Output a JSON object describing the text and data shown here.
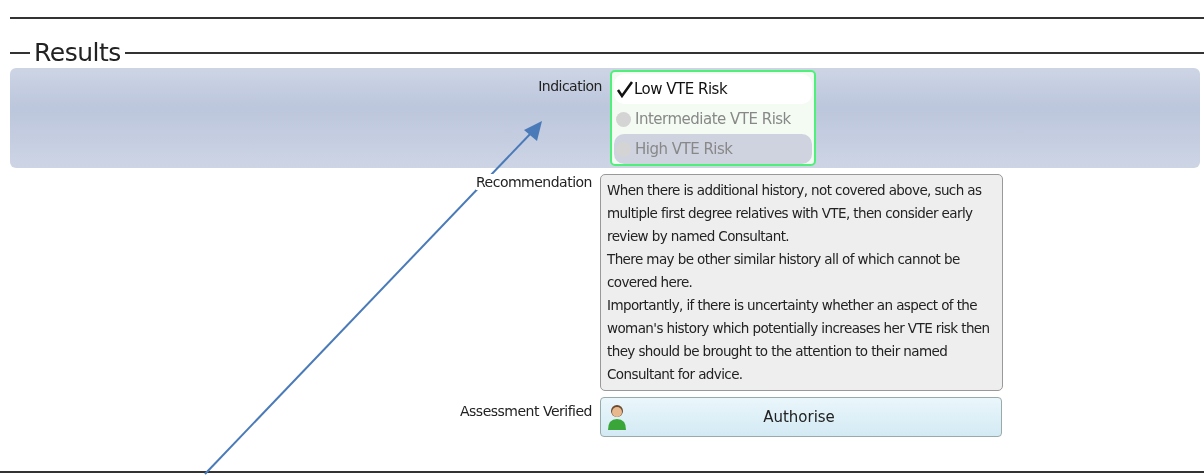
{
  "section": {
    "title": "Results"
  },
  "indication": {
    "label": "Indication",
    "options": [
      {
        "label": "Low VTE Risk",
        "selected": true,
        "hovered": false
      },
      {
        "label": "Intermediate VTE Risk",
        "selected": false,
        "hovered": false
      },
      {
        "label": "High VTE Risk",
        "selected": false,
        "hovered": true
      }
    ]
  },
  "recommendation": {
    "label": "Recommendation",
    "paragraphs": [
      "When there is additional history, not covered above, such as multiple first degree relatives with VTE, then consider early review by named Consultant.",
      "There may be other similar history all of which cannot be covered here.",
      "Importantly, if there is uncertainty whether an aspect of the woman's history which potentially increases her VTE risk then they should be brought to the attention to their named Consultant for advice."
    ]
  },
  "verification": {
    "label": "Assessment Verified",
    "button": "Authorise"
  }
}
